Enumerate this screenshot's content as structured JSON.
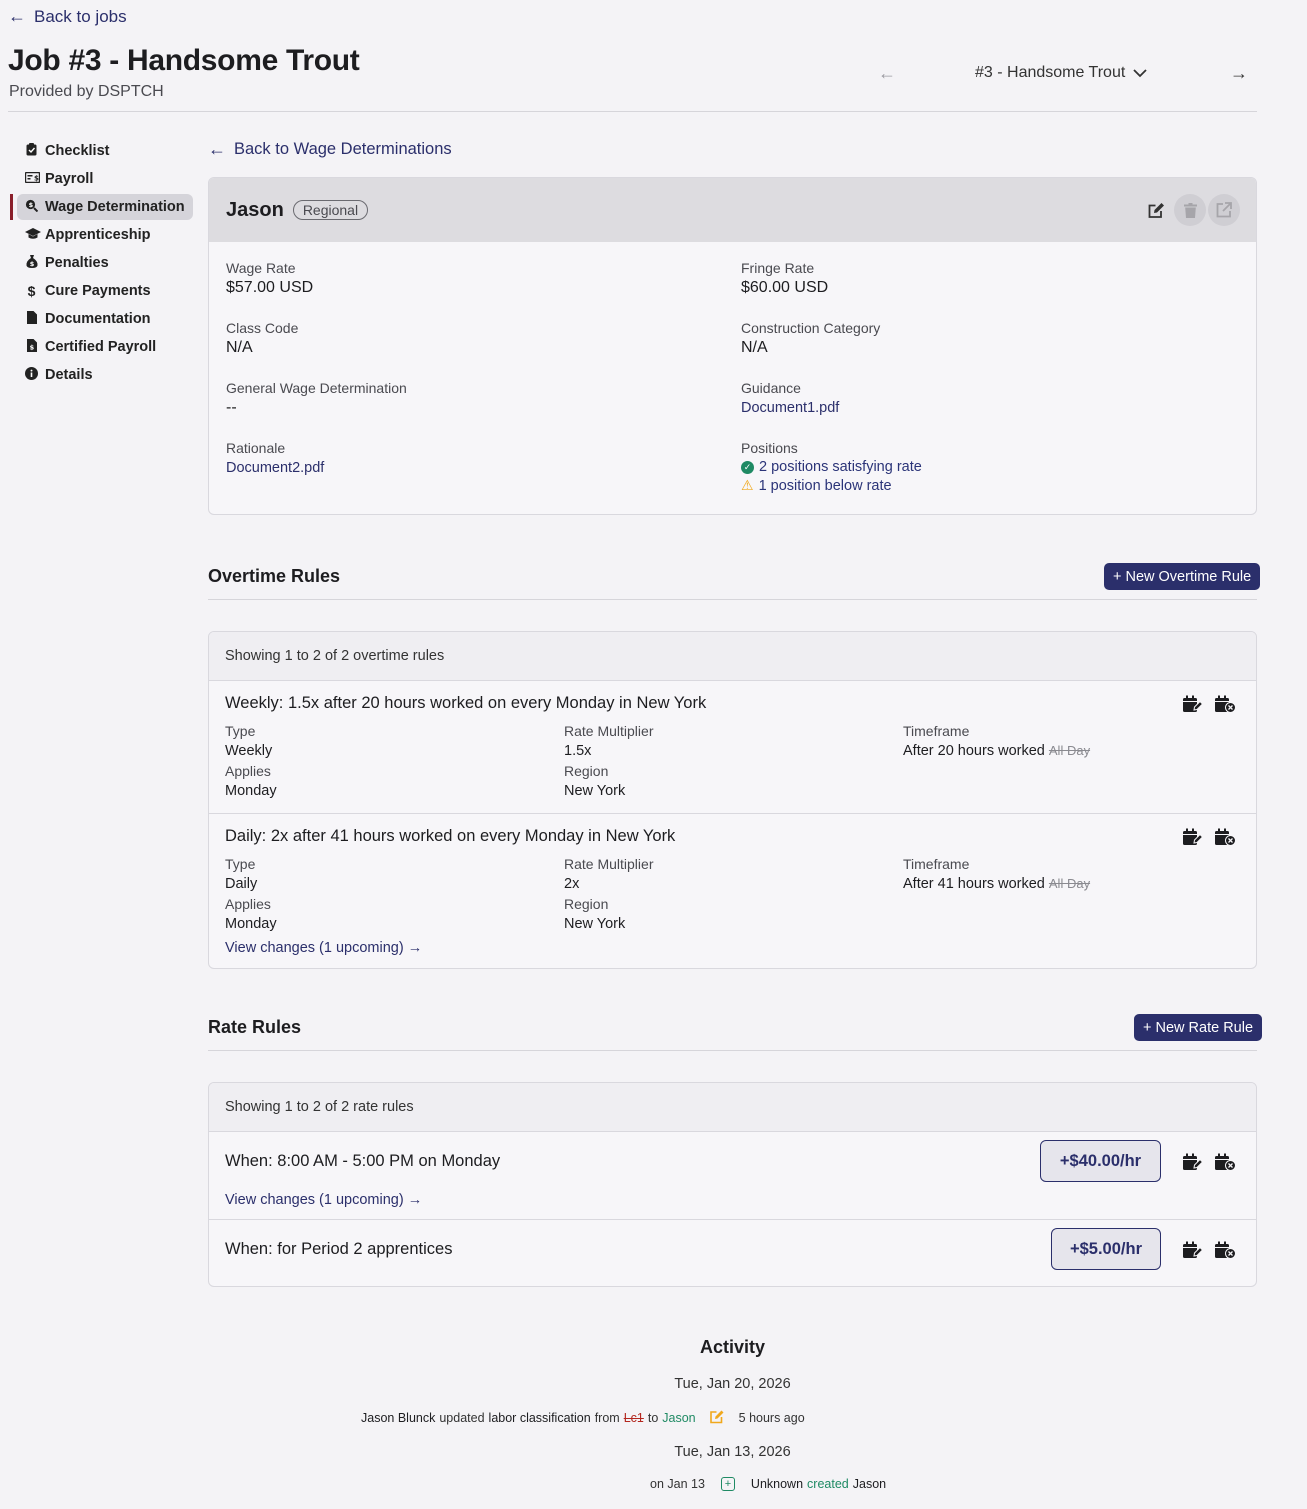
{
  "header": {
    "back_label": "Back to jobs",
    "title": "Job #3 - Handsome Trout",
    "provider": "Provided by DSPTCH",
    "job_selector": "#3 - Handsome Trout"
  },
  "sidebar": {
    "items": [
      {
        "label": "Checklist",
        "icon": "clipboard-check-icon",
        "active": false
      },
      {
        "label": "Payroll",
        "icon": "money-check-icon",
        "active": false
      },
      {
        "label": "Wage Determination",
        "icon": "search-dollar-icon",
        "active": true
      },
      {
        "label": "Apprenticeship",
        "icon": "graduation-cap-icon",
        "active": false
      },
      {
        "label": "Penalties",
        "icon": "money-bag-icon",
        "active": false
      },
      {
        "label": "Cure Payments",
        "icon": "dollar-icon",
        "active": false
      },
      {
        "label": "Documentation",
        "icon": "file-icon",
        "active": false
      },
      {
        "label": "Certified Payroll",
        "icon": "file-invoice-dollar-icon",
        "active": false
      },
      {
        "label": "Details",
        "icon": "info-circle-icon",
        "active": false
      }
    ]
  },
  "main": {
    "back_label": "Back to Wage Determinations",
    "determination": {
      "name": "Jason",
      "badge": "Regional",
      "fields": {
        "wage_rate_label": "Wage Rate",
        "wage_rate": "$57.00 USD",
        "fringe_rate_label": "Fringe Rate",
        "fringe_rate": "$60.00 USD",
        "class_code_label": "Class Code",
        "class_code": "N/A",
        "construction_category_label": "Construction Category",
        "construction_category": "N/A",
        "general_wage_label": "General Wage Determination",
        "general_wage": "--",
        "guidance_label": "Guidance",
        "guidance": "Document1.pdf",
        "rationale_label": "Rationale",
        "rationale": "Document2.pdf",
        "positions_label": "Positions",
        "positions_ok": "2 positions satisfying rate",
        "positions_below": "1 position below rate"
      }
    },
    "overtime": {
      "title": "Overtime Rules",
      "new_button": "+ New Overtime Rule",
      "info": "Showing 1 to 2 of 2 overtime rules",
      "labels": {
        "type": "Type",
        "applies": "Applies",
        "multiplier": "Rate Multiplier",
        "region": "Region",
        "timeframe": "Timeframe"
      },
      "rules": [
        {
          "title": "Weekly: 1.5x after 20 hours worked on every Monday in New York",
          "type": "Weekly",
          "applies": "Monday",
          "multiplier": "1.5x",
          "region": "New York",
          "timeframe": "After 20 hours worked",
          "timeframe_strike": "All Day",
          "changes": ""
        },
        {
          "title": "Daily: 2x after 41 hours worked on every Monday in New York",
          "type": "Daily",
          "applies": "Monday",
          "multiplier": "2x",
          "region": "New York",
          "timeframe": "After 41 hours worked",
          "timeframe_strike": "All Day",
          "changes": "View changes (1 upcoming) →"
        }
      ]
    },
    "rate": {
      "title": "Rate Rules",
      "new_button": "+ New Rate Rule",
      "info": "Showing 1 to 2 of 2 rate rules",
      "rules": [
        {
          "text": "When: 8:00 AM - 5:00 PM on Monday",
          "amount": "+$40.00/hr",
          "changes": "View changes (1 upcoming) →"
        },
        {
          "text": "When: for Period 2 apprentices",
          "amount": "+$5.00/hr",
          "changes": ""
        }
      ]
    },
    "activity": {
      "title": "Activity",
      "groups": [
        {
          "date": "Tue, Jan 20, 2026",
          "entry": {
            "user": "Jason Blunck",
            "verb": "updated",
            "object": "labor classification",
            "from_word": "from",
            "old": "Lc1",
            "to_word": "to",
            "new": "Jason",
            "time": "5 hours ago"
          }
        },
        {
          "date": "Tue, Jan 13, 2026",
          "entry": {
            "time": "on Jan 13",
            "user": "Unknown",
            "verb": "created",
            "object": "Jason"
          }
        }
      ]
    }
  },
  "colors": {
    "brand": "#2b2f6b",
    "active_marker": "#8a1f2b",
    "success": "#1f8a64",
    "warning": "#f0a81c",
    "danger": "#b3261e",
    "background": "#f4f3f6"
  }
}
